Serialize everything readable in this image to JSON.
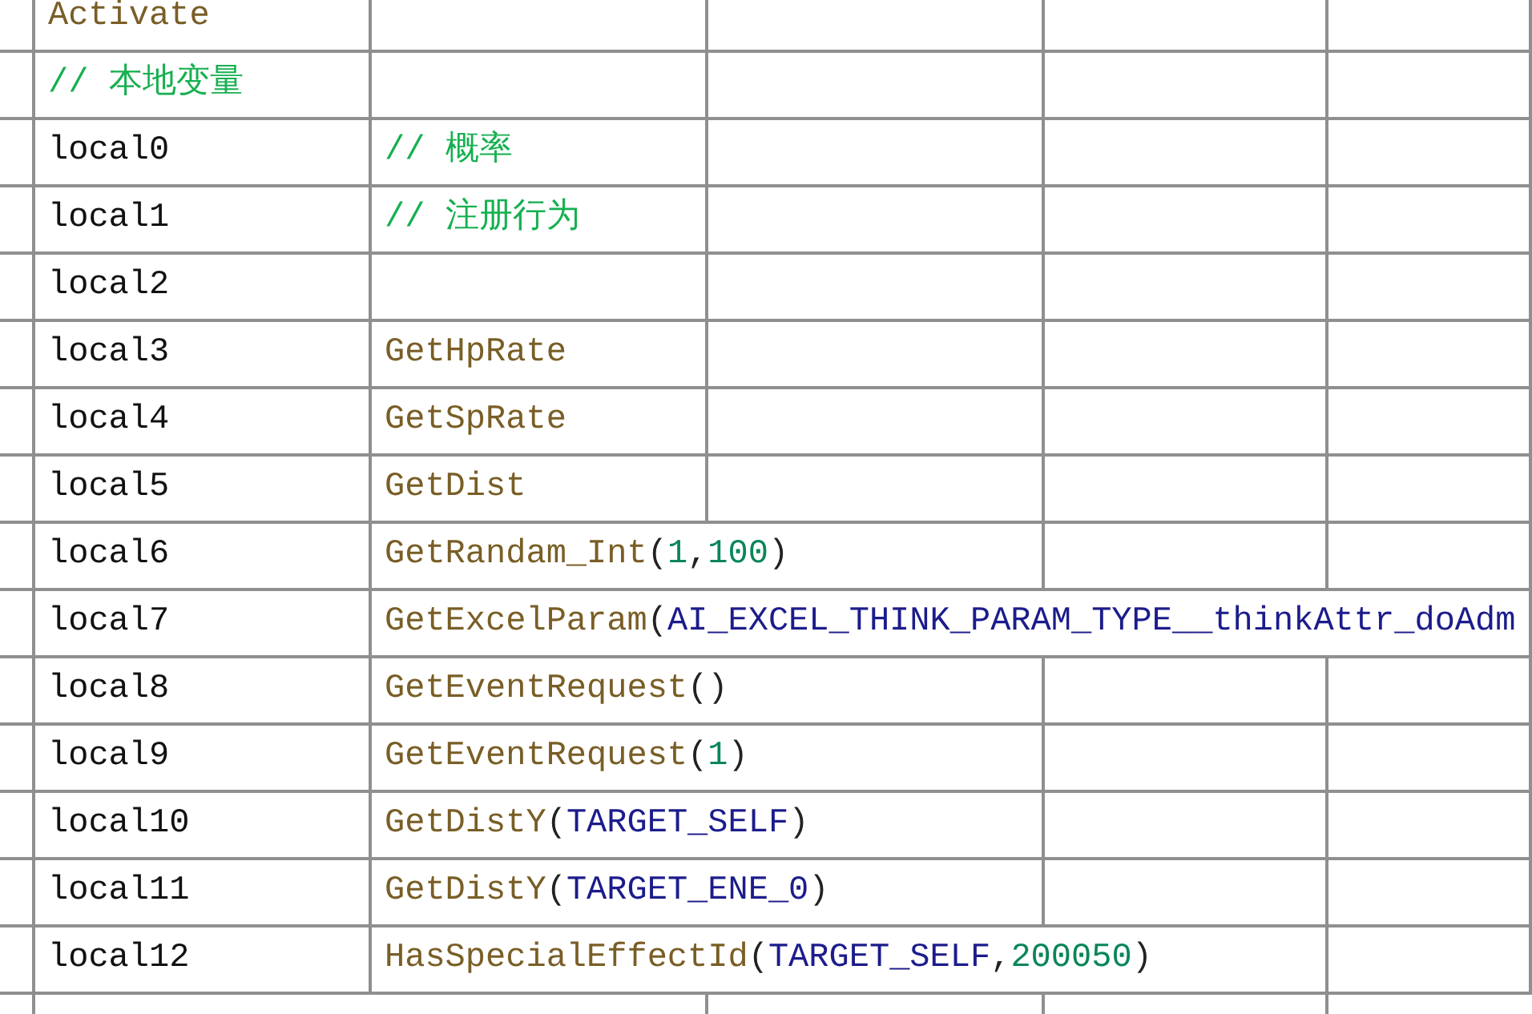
{
  "rows": [
    {
      "cells": [
        {
          "tokens": [
            {
              "kind": "func",
              "text": "Activate"
            }
          ]
        }
      ]
    },
    {
      "cells": [
        {
          "tokens": [
            {
              "kind": "comment",
              "text": "// 本地变量"
            }
          ]
        }
      ]
    },
    {
      "cells": [
        {
          "tokens": [
            {
              "kind": "plain",
              "text": "local0"
            }
          ]
        },
        {
          "tokens": [
            {
              "kind": "comment",
              "text": "// 概率"
            }
          ]
        }
      ]
    },
    {
      "cells": [
        {
          "tokens": [
            {
              "kind": "plain",
              "text": "local1"
            }
          ]
        },
        {
          "tokens": [
            {
              "kind": "comment",
              "text": "// 注册行为"
            }
          ]
        }
      ]
    },
    {
      "cells": [
        {
          "tokens": [
            {
              "kind": "plain",
              "text": "local2"
            }
          ]
        }
      ]
    },
    {
      "cells": [
        {
          "tokens": [
            {
              "kind": "plain",
              "text": "local3"
            }
          ]
        },
        {
          "tokens": [
            {
              "kind": "func",
              "text": "GetHpRate"
            }
          ]
        }
      ]
    },
    {
      "cells": [
        {
          "tokens": [
            {
              "kind": "plain",
              "text": "local4"
            }
          ]
        },
        {
          "tokens": [
            {
              "kind": "func",
              "text": "GetSpRate"
            }
          ]
        }
      ]
    },
    {
      "cells": [
        {
          "tokens": [
            {
              "kind": "plain",
              "text": "local5"
            }
          ]
        },
        {
          "tokens": [
            {
              "kind": "func",
              "text": "GetDist"
            }
          ]
        }
      ]
    },
    {
      "cells": [
        {
          "tokens": [
            {
              "kind": "plain",
              "text": "local6"
            }
          ]
        },
        {
          "tokens": [
            {
              "kind": "func",
              "text": "GetRandam_Int"
            },
            {
              "kind": "punct",
              "text": "("
            },
            {
              "kind": "number",
              "text": "1"
            },
            {
              "kind": "punct",
              "text": ","
            },
            {
              "kind": "number",
              "text": "100"
            },
            {
              "kind": "punct",
              "text": ")"
            }
          ]
        }
      ]
    },
    {
      "cells": [
        {
          "tokens": [
            {
              "kind": "plain",
              "text": "local7"
            }
          ]
        },
        {
          "tokens": [
            {
              "kind": "func",
              "text": "GetExcelParam"
            },
            {
              "kind": "punct",
              "text": "("
            },
            {
              "kind": "const",
              "text": "AI_EXCEL_THINK_PARAM_TYPE__thinkAttr_doAdm"
            }
          ]
        }
      ]
    },
    {
      "cells": [
        {
          "tokens": [
            {
              "kind": "plain",
              "text": "local8"
            }
          ]
        },
        {
          "tokens": [
            {
              "kind": "func",
              "text": "GetEventRequest"
            },
            {
              "kind": "punct",
              "text": "()"
            }
          ]
        }
      ]
    },
    {
      "cells": [
        {
          "tokens": [
            {
              "kind": "plain",
              "text": "local9"
            }
          ]
        },
        {
          "tokens": [
            {
              "kind": "func",
              "text": "GetEventRequest"
            },
            {
              "kind": "punct",
              "text": "("
            },
            {
              "kind": "number",
              "text": "1"
            },
            {
              "kind": "punct",
              "text": ")"
            }
          ]
        }
      ]
    },
    {
      "cells": [
        {
          "tokens": [
            {
              "kind": "plain",
              "text": "local10"
            }
          ]
        },
        {
          "tokens": [
            {
              "kind": "func",
              "text": "GetDistY"
            },
            {
              "kind": "punct",
              "text": "("
            },
            {
              "kind": "const",
              "text": "TARGET_SELF"
            },
            {
              "kind": "punct",
              "text": ")"
            }
          ]
        }
      ]
    },
    {
      "cells": [
        {
          "tokens": [
            {
              "kind": "plain",
              "text": "local11"
            }
          ]
        },
        {
          "tokens": [
            {
              "kind": "func",
              "text": "GetDistY"
            },
            {
              "kind": "punct",
              "text": "("
            },
            {
              "kind": "const",
              "text": "TARGET_ENE_0"
            },
            {
              "kind": "punct",
              "text": ")"
            }
          ]
        }
      ]
    },
    {
      "cells": [
        {
          "tokens": [
            {
              "kind": "plain",
              "text": "local12"
            }
          ]
        },
        {
          "tokens": [
            {
              "kind": "func",
              "text": "HasSpecialEffectId"
            },
            {
              "kind": "punct",
              "text": "("
            },
            {
              "kind": "const",
              "text": "TARGET_SELF"
            },
            {
              "kind": "punct",
              "text": ","
            },
            {
              "kind": "number",
              "text": "200050"
            },
            {
              "kind": "punct",
              "text": ")"
            }
          ]
        }
      ]
    }
  ]
}
